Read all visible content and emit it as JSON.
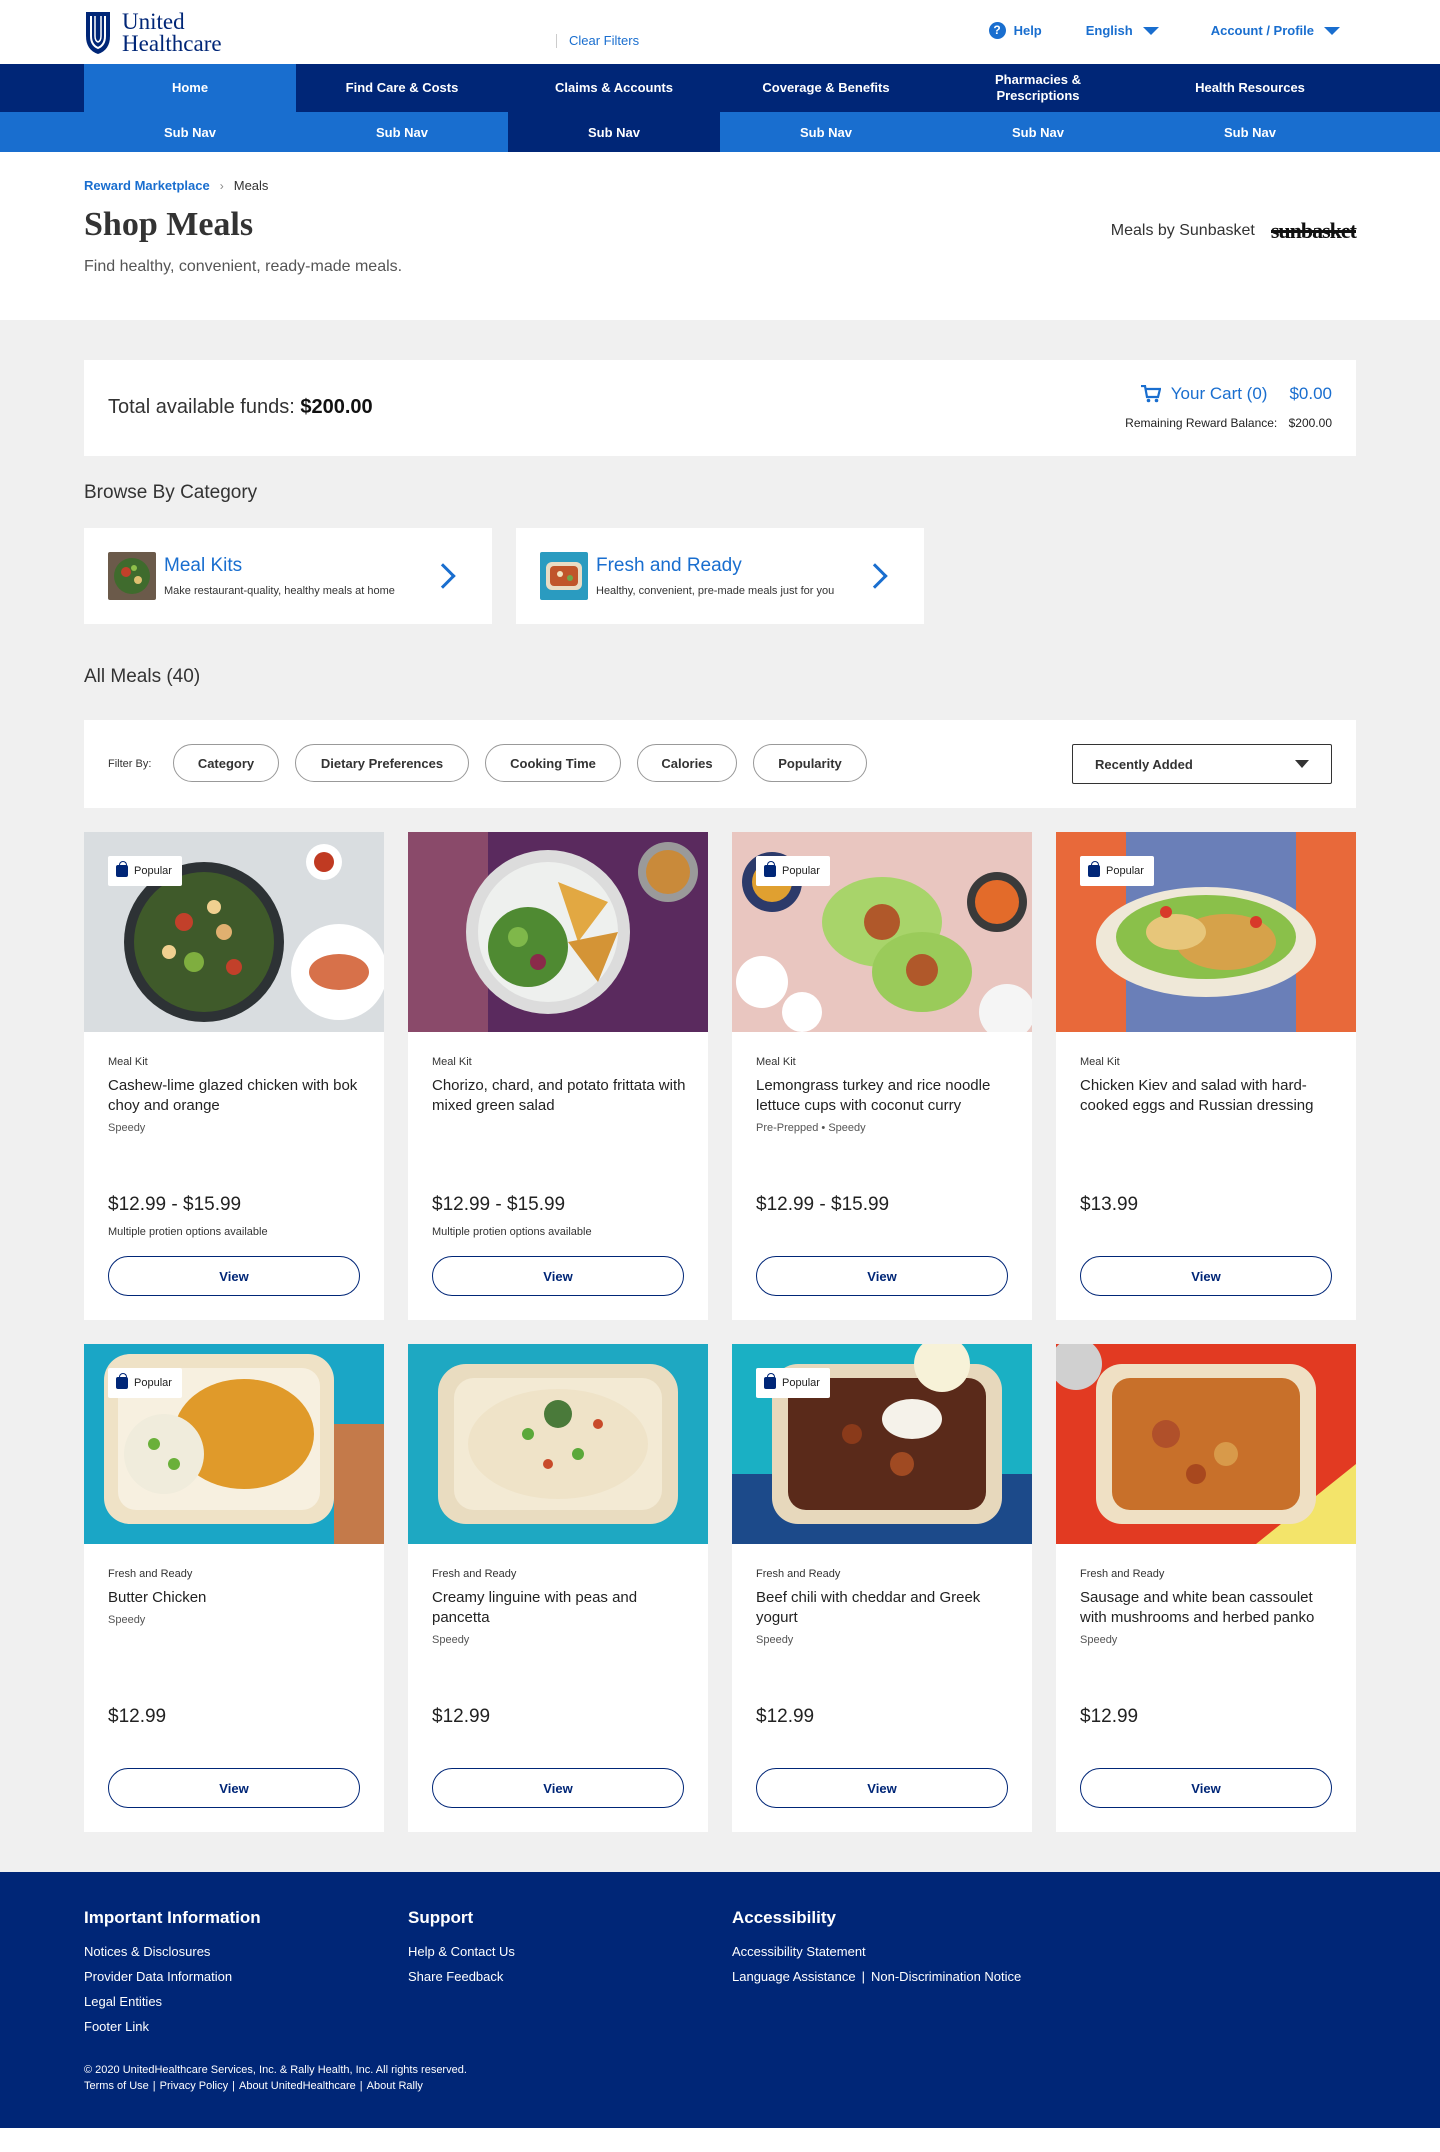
{
  "header": {
    "logo_line1": "United",
    "logo_line2": "Healthcare",
    "clear_filters": "Clear Filters",
    "help": "Help",
    "language": "English",
    "account": "Account / Profile"
  },
  "nav": {
    "items": [
      "Home",
      "Find Care & Costs",
      "Claims & Accounts",
      "Coverage & Benefits",
      "Pharmacies & Prescriptions",
      "Health Resources"
    ],
    "sub_items": [
      "Sub Nav",
      "Sub Nav",
      "Sub Nav",
      "Sub Nav",
      "Sub Nav",
      "Sub Nav"
    ]
  },
  "breadcrumb": {
    "parent": "Reward Marketplace",
    "current": "Meals"
  },
  "page": {
    "title": "Shop Meals",
    "subtitle": "Find healthy, convenient, ready-made meals.",
    "partner_text": "Meals by Sunbasket",
    "partner_logo": "sunbasket"
  },
  "funds": {
    "label": "Total available funds:",
    "amount": "$200.00",
    "cart_label": "Your Cart (0)",
    "cart_amount": "$0.00",
    "remaining_label": "Remaining Reward Balance:",
    "remaining_value": "$200.00"
  },
  "browse": {
    "title": "Browse By Category",
    "categories": [
      {
        "title": "Meal Kits",
        "desc": "Make restaurant-quality, healthy meals at home"
      },
      {
        "title": "Fresh and Ready",
        "desc": "Healthy, convenient, pre-made meals just for you"
      }
    ]
  },
  "all_meals": {
    "title": "All Meals (40)",
    "filter_label": "Filter By:",
    "filters": [
      "Category",
      "Dietary Preferences",
      "Cooking Time",
      "Calories",
      "Popularity"
    ],
    "sort": "Recently Added",
    "view_label": "View",
    "popular_label": "Popular"
  },
  "meals": [
    {
      "category": "Meal Kit",
      "title": "Cashew-lime glazed chicken with bok choy and orange",
      "tags": "Speedy",
      "price": "$12.99 - $15.99",
      "note": "Multiple protien options available",
      "popular": true
    },
    {
      "category": "Meal Kit",
      "title": "Chorizo, chard, and potato frittata with mixed green salad",
      "tags": "",
      "price": "$12.99 - $15.99",
      "note": "Multiple protien options available",
      "popular": false
    },
    {
      "category": "Meal Kit",
      "title": "Lemongrass turkey and rice noodle lettuce cups with coconut curry",
      "tags": "Pre-Prepped • Speedy",
      "price": "$12.99 - $15.99",
      "note": "",
      "popular": true
    },
    {
      "category": "Meal Kit",
      "title": "Chicken Kiev and salad with hard-cooked eggs and Russian dressing",
      "tags": "",
      "price": "$13.99",
      "note": "",
      "popular": true
    },
    {
      "category": "Fresh and Ready",
      "title": "Butter Chicken",
      "tags": "Speedy",
      "price": "$12.99",
      "note": "",
      "popular": true
    },
    {
      "category": "Fresh and Ready",
      "title": "Creamy linguine with peas and pancetta",
      "tags": "Speedy",
      "price": "$12.99",
      "note": "",
      "popular": false
    },
    {
      "category": "Fresh and Ready",
      "title": "Beef chili with cheddar and Greek yogurt",
      "tags": "Speedy",
      "price": "$12.99",
      "note": "",
      "popular": true
    },
    {
      "category": "Fresh and Ready",
      "title": "Sausage and white bean cassoulet with mushrooms and herbed panko",
      "tags": "Speedy",
      "price": "$12.99",
      "note": "",
      "popular": false
    }
  ],
  "footer": {
    "col1_title": "Important Information",
    "col1_links": [
      "Notices & Disclosures",
      "Provider Data Information",
      "Legal Entities",
      "Footer Link"
    ],
    "col2_title": "Support",
    "col2_links": [
      "Help & Contact Us",
      "Share Feedback"
    ],
    "col3_title": "Accessibility",
    "col3_link1": "Accessibility Statement",
    "col3_link2": "Language Assistance",
    "col3_link3": "Non-Discrimination Notice",
    "copyright": "© 2020 UnitedHealthcare Services, Inc. & Rally Health, Inc. All rights reserved.",
    "legal_links": [
      "Terms of Use",
      "Privacy Policy",
      "About UnitedHealthcare",
      "About Rally"
    ]
  },
  "colors": {
    "brand_navy": "#002677",
    "brand_blue": "#196ecf",
    "page_gray": "#f0f0f0"
  }
}
